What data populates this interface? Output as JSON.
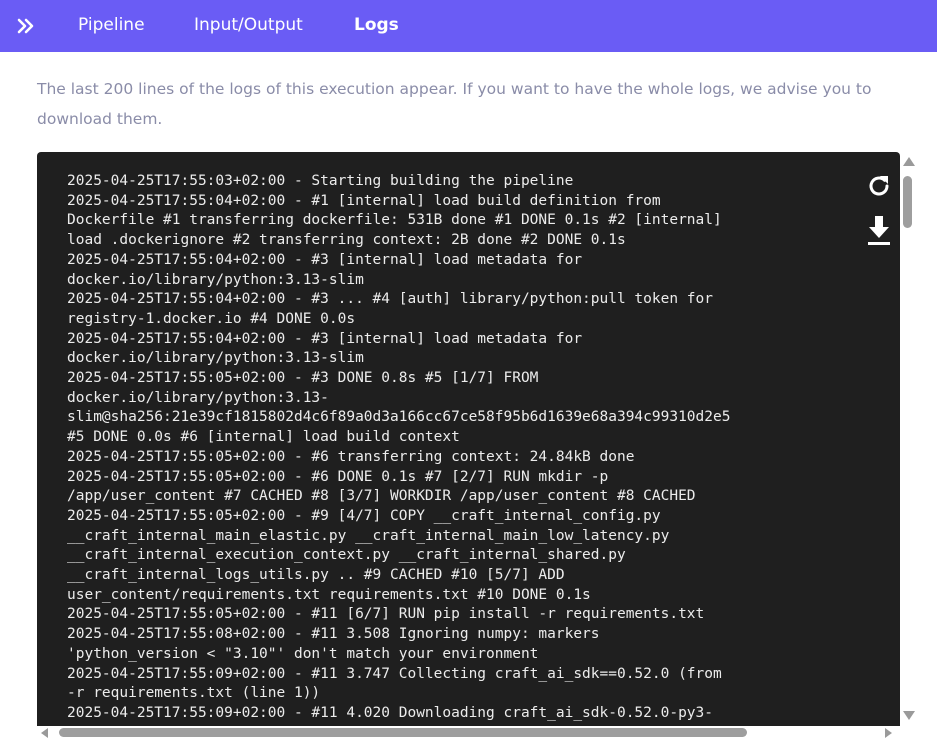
{
  "nav": {
    "expand_icon": "double-chevron-right-icon",
    "tabs": [
      {
        "label": "Pipeline",
        "active": false
      },
      {
        "label": "Input/Output",
        "active": false
      },
      {
        "label": "Logs",
        "active": true
      }
    ],
    "background_color": "#6a5cf5"
  },
  "intro_text": "The last 200 lines of the logs of this execution appear. If you want to have the whole logs, we advise you to download them.",
  "logs": {
    "lines": [
      "2025-04-25T17:55:03+02:00 - Starting building the pipeline",
      "2025-04-25T17:55:04+02:00 - #1 [internal] load build definition from",
      "Dockerfile #1 transferring dockerfile: 531B done #1 DONE 0.1s #2 [internal]",
      "load .dockerignore #2 transferring context: 2B done #2 DONE 0.1s",
      "2025-04-25T17:55:04+02:00 - #3 [internal] load metadata for",
      "docker.io/library/python:3.13-slim",
      "2025-04-25T17:55:04+02:00 - #3 ... #4 [auth] library/python:pull token for",
      "registry-1.docker.io #4 DONE 0.0s",
      "2025-04-25T17:55:04+02:00 - #3 [internal] load metadata for",
      "docker.io/library/python:3.13-slim",
      "2025-04-25T17:55:05+02:00 - #3 DONE 0.8s #5 [1/7] FROM",
      "docker.io/library/python:3.13-",
      "slim@sha256:21e39cf1815802d4c6f89a0d3a166cc67ce58f95b6d1639e68a394c99310d2e5",
      "#5 DONE 0.0s #6 [internal] load build context",
      "2025-04-25T17:55:05+02:00 - #6 transferring context: 24.84kB done",
      "2025-04-25T17:55:05+02:00 - #6 DONE 0.1s #7 [2/7] RUN mkdir -p",
      "/app/user_content #7 CACHED #8 [3/7] WORKDIR /app/user_content #8 CACHED",
      "2025-04-25T17:55:05+02:00 - #9 [4/7] COPY __craft_internal_config.py",
      "__craft_internal_main_elastic.py __craft_internal_main_low_latency.py",
      "__craft_internal_execution_context.py __craft_internal_shared.py",
      "__craft_internal_logs_utils.py .. #9 CACHED #10 [5/7] ADD",
      "user_content/requirements.txt requirements.txt #10 DONE 0.1s",
      "2025-04-25T17:55:05+02:00 - #11 [6/7] RUN pip install -r requirements.txt",
      "2025-04-25T17:55:08+02:00 - #11 3.508 Ignoring numpy: markers",
      "'python_version < \"3.10\"' don't match your environment",
      "2025-04-25T17:55:09+02:00 - #11 3.747 Collecting craft_ai_sdk==0.52.0 (from",
      "-r requirements.txt (line 1))",
      "2025-04-25T17:55:09+02:00 - #11 4.020 Downloading craft_ai_sdk-0.52.0-py3-"
    ],
    "refresh_icon": "refresh-icon",
    "download_icon": "download-icon",
    "background_color": "#1f1f1f"
  }
}
